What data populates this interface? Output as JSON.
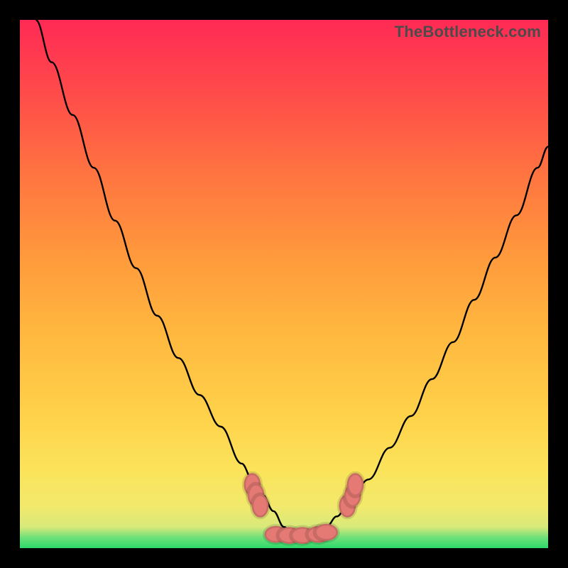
{
  "watermark": {
    "text": "TheBottleneck.com"
  },
  "colors": {
    "frame": "#000000",
    "curve": "#000000",
    "marker": "#e47a73",
    "gradient_stops": [
      "#2dd96b",
      "#6ee07a",
      "#d8e97a",
      "#f2e96c",
      "#fbe35a",
      "#ffd24a",
      "#ffb93f",
      "#ff9a3c",
      "#ff7640",
      "#ff4e49",
      "#ff2a55"
    ]
  },
  "chart_data": {
    "type": "line",
    "title": "",
    "xlabel": "",
    "ylabel": "",
    "xlim": [
      0,
      100
    ],
    "ylim": [
      0,
      100
    ],
    "series": [
      {
        "name": "bottleneck-curve-left",
        "x": [
          3,
          6,
          10,
          14,
          18,
          22,
          26,
          30,
          34,
          38,
          42,
          44,
          46,
          48,
          50,
          52,
          54
        ],
        "values": [
          100,
          92,
          82,
          72,
          62,
          53,
          44,
          36,
          29,
          23,
          16,
          13,
          10,
          7,
          4,
          2,
          1
        ]
      },
      {
        "name": "bottleneck-curve-right",
        "x": [
          54,
          56,
          58,
          60,
          62,
          66,
          70,
          74,
          78,
          82,
          86,
          90,
          94,
          98,
          100
        ],
        "values": [
          1,
          2,
          4,
          6,
          8,
          13,
          19,
          25,
          32,
          39,
          47,
          55,
          63,
          72,
          76
        ]
      }
    ],
    "markers": {
      "name": "bottleneck-trough-markers",
      "x": [
        44.0,
        44.7,
        45.5,
        48.5,
        51.0,
        53.5,
        56.5,
        58.0,
        62.0,
        63.0,
        63.5
      ],
      "values": [
        12.0,
        10.0,
        8.0,
        2.6,
        2.4,
        2.4,
        2.6,
        3.0,
        8.0,
        10.0,
        12.0
      ],
      "rx": [
        1.6,
        1.6,
        1.6,
        2.2,
        2.2,
        2.2,
        2.2,
        2.2,
        1.6,
        1.6,
        1.6
      ],
      "ry": [
        2.2,
        2.2,
        2.2,
        1.6,
        1.6,
        1.6,
        1.6,
        1.6,
        2.2,
        2.2,
        2.2
      ]
    }
  }
}
